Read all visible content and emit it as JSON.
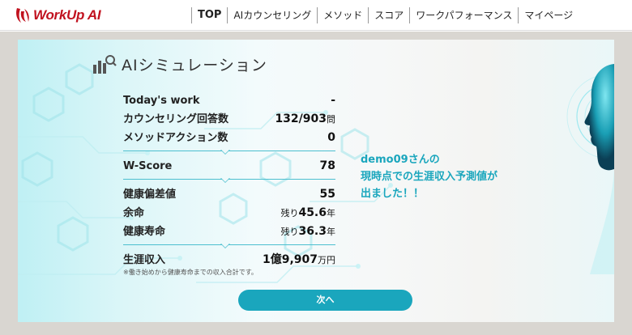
{
  "header": {
    "logo_text": "WorkUp AI",
    "nav": [
      "TOP",
      "AIカウンセリング",
      "メソッド",
      "スコア",
      "ワークパフォーマンス",
      "マイページ"
    ]
  },
  "panel": {
    "title": "AIシミュレーション",
    "stats": {
      "todays_work_label": "Today's work",
      "todays_work_value": "-",
      "counseling_label": "カウンセリング回答数",
      "counseling_value": "132/903",
      "counseling_unit": "問",
      "method_label": "メソッドアクション数",
      "method_value": "0",
      "wscore_label": "W-Score",
      "wscore_value": "78",
      "health_dev_label": "健康偏差値",
      "health_dev_value": "55",
      "life_label": "余命",
      "life_pre": "残り",
      "life_value": "45.6",
      "life_unit": "年",
      "healthy_life_label": "健康寿命",
      "healthy_life_pre": "残り",
      "healthy_life_value": "36.3",
      "healthy_life_unit": "年",
      "lifetime_income_label": "生涯収入",
      "lifetime_income_value": "1億9,907",
      "lifetime_income_unit": "万円",
      "note": "※働き始めから健康寿命までの収入合計です。"
    },
    "message_lines": [
      "demo09さんの",
      "現時点での生涯収入予測値が",
      "出ました！！"
    ],
    "next_label": "次へ"
  },
  "colors": {
    "brand_red": "#c1121f",
    "accent_teal": "#1aa6bd",
    "divider": "#4cbfcf"
  },
  "icons": [
    "workup-logo-icon",
    "chart-search-icon",
    "ai-head-illustration"
  ]
}
